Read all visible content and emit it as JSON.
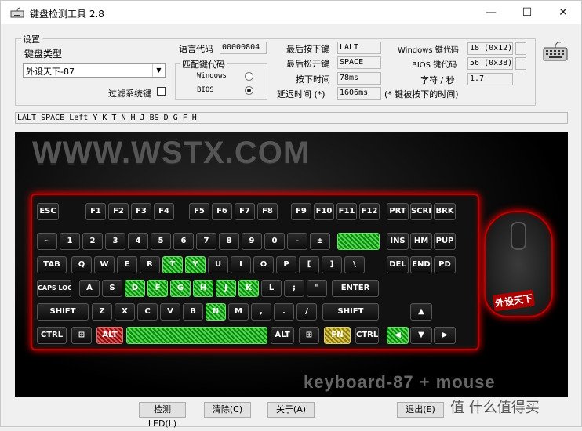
{
  "window": {
    "title": "键盘检测工具 2.8",
    "min": "—",
    "max": "☐",
    "close": "✕"
  },
  "settings": {
    "group_label": "设置",
    "kbtype_label": "键盘类型",
    "kbtype_value": "外设天下-87",
    "filter_label": "过滤系统键"
  },
  "lang": {
    "label": "语言代码",
    "value": "00000804"
  },
  "match": {
    "label": "匹配键代码",
    "opt1": "Windows",
    "opt2": "BIOS"
  },
  "info": {
    "last_press_label": "最后按下键",
    "last_press": "LALT",
    "last_release_label": "最后松开键",
    "last_release": "SPACE",
    "press_time_label": "按下时间",
    "press_time": "78ms",
    "delay_label": "延迟时间 (*)",
    "delay": "1606ms",
    "delay_note": "(* 键被按下的时间)",
    "win_code_label": "Windows 键代码",
    "win_code": "18 (0x12)",
    "bios_code_label": "BIOS 键代码",
    "bios_code": "56 (0x38)",
    "cps_label": "字符 / 秒",
    "cps": "1.7"
  },
  "history": "LALT SPACE Left Y K T N H J BS D G F H",
  "banner": {
    "brand": "WWW.WSTX.COM",
    "model": "keyboard-87 + mouse",
    "mouse_logo": "外设天下"
  },
  "keys": {
    "esc": "ESC",
    "f": [
      "F1",
      "F2",
      "F3",
      "F4",
      "F5",
      "F6",
      "F7",
      "F8",
      "F9",
      "F10",
      "F11",
      "F12"
    ],
    "prt": "PRT",
    "scr": "SCRL",
    "brk": "BRK",
    "num": [
      "~",
      "1",
      "2",
      "3",
      "4",
      "5",
      "6",
      "7",
      "8",
      "9",
      "0",
      "-",
      "±"
    ],
    "ins": "INS",
    "hm": "HM",
    "pup": "PUP",
    "tab": "TAB",
    "q": [
      "Q",
      "W",
      "E",
      "R",
      "T",
      "Y",
      "U",
      "I",
      "O",
      "P",
      "[",
      "]",
      "\\"
    ],
    "del": "DEL",
    "end": "END",
    "pd": "PD",
    "caps": "CAPS LOCK",
    "a": [
      "A",
      "S",
      "D",
      "F",
      "G",
      "H",
      "J",
      "K",
      "L",
      ";",
      "\""
    ],
    "enter": "ENTER",
    "shift": "SHIFT",
    "z": [
      "Z",
      "X",
      "C",
      "V",
      "B",
      "N",
      "M",
      ",",
      ".",
      "/"
    ],
    "ctrl": "CTRL",
    "alt": "ALT",
    "fn": "FN",
    "win": "⊞",
    "up": "▲",
    "down": "▼",
    "left": "◀",
    "right": "▶"
  },
  "buttons": {
    "led": "检测LED(L)",
    "clear": "清除(C)",
    "about": "关于(A)",
    "exit": "退出(E)"
  },
  "watermark": "值 什么值得买"
}
